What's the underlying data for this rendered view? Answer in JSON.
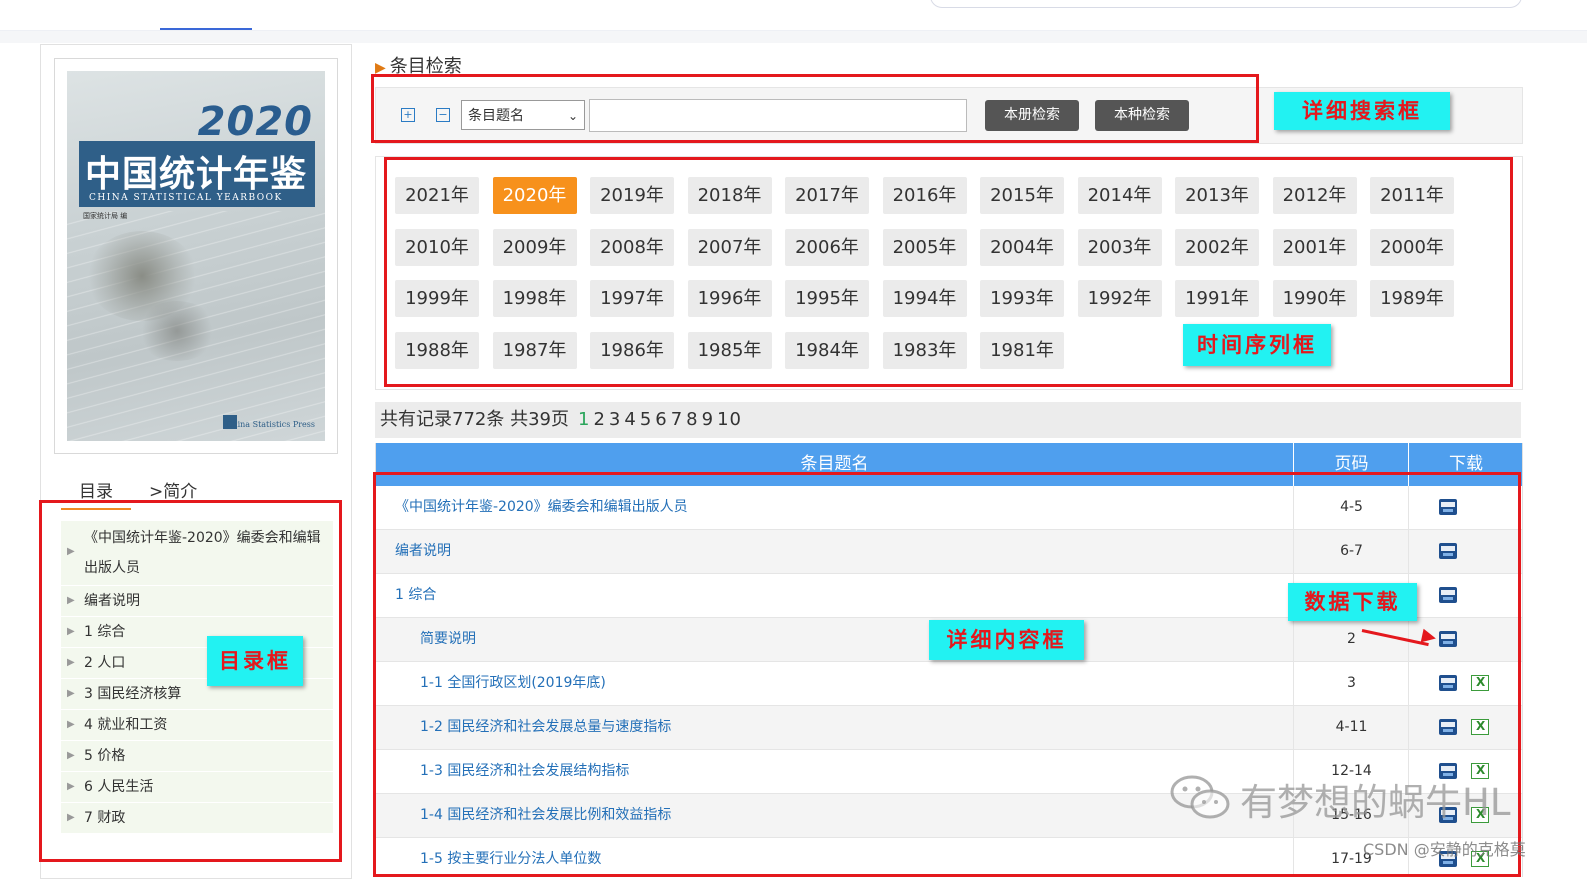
{
  "cover": {
    "year": "2020",
    "title_cn": "中国统计年鉴",
    "title_en": "CHINA STATISTICAL YEARBOOK",
    "editor": "国家统计局 编",
    "publisher": "China Statistics Press"
  },
  "left_tabs": {
    "catalog": "目录",
    "intro": ">简介"
  },
  "toc": [
    "《中国统计年鉴-2020》编委会和编辑出版人员",
    "编者说明",
    "1 综合",
    "2 人口",
    "3 国民经济核算",
    "4 就业和工资",
    "5 价格",
    "6 人民生活",
    "7 财政"
  ],
  "section_title": "条目检索",
  "search": {
    "field_selected": "条目题名",
    "input_value": "",
    "btn_this_volume": "本册检索",
    "btn_this_type": "本种检索"
  },
  "years": [
    "2021年",
    "2020年",
    "2019年",
    "2018年",
    "2017年",
    "2016年",
    "2015年",
    "2014年",
    "2013年",
    "2012年",
    "2011年",
    "2010年",
    "2009年",
    "2008年",
    "2007年",
    "2006年",
    "2005年",
    "2004年",
    "2003年",
    "2002年",
    "2001年",
    "2000年",
    "1999年",
    "1998年",
    "1997年",
    "1996年",
    "1995年",
    "1994年",
    "1993年",
    "1992年",
    "1991年",
    "1990年",
    "1989年",
    "1988年",
    "1987年",
    "1986年",
    "1985年",
    "1984年",
    "1983年",
    "1981年"
  ],
  "active_year": "2020年",
  "records": {
    "summary": "共有记录772条  共39页",
    "pages": [
      "1",
      "2",
      "3",
      "4",
      "5",
      "6",
      "7",
      "8",
      "9",
      "10"
    ],
    "current_page": "1"
  },
  "table": {
    "headers": {
      "title": "条目题名",
      "page": "页码",
      "download": "下载"
    },
    "rows": [
      {
        "title": "《中国统计年鉴-2020》编委会和编辑出版人员",
        "page": "4-5",
        "indent": 0,
        "excel": false
      },
      {
        "title": "编者说明",
        "page": "6-7",
        "indent": 0,
        "excel": false
      },
      {
        "title": "1 综合",
        "page": "",
        "indent": 0,
        "excel": false
      },
      {
        "title": "简要说明",
        "page": "2",
        "indent": 1,
        "excel": false
      },
      {
        "title": "1-1 全国行政区划(2019年底)",
        "page": "3",
        "indent": 1,
        "excel": true
      },
      {
        "title": "1-2 国民经济和社会发展总量与速度指标",
        "page": "4-11",
        "indent": 1,
        "excel": true
      },
      {
        "title": "1-3 国民经济和社会发展结构指标",
        "page": "12-14",
        "indent": 1,
        "excel": true
      },
      {
        "title": "1-4 国民经济和社会发展比例和效益指标",
        "page": "15-16",
        "indent": 1,
        "excel": true
      },
      {
        "title": "1-5 按主要行业分法人单位数",
        "page": "17-19",
        "indent": 1,
        "excel": true
      }
    ]
  },
  "annotations": {
    "search_box": "详细搜索框",
    "time_series": "时间序列框",
    "catalog_box": "目录框",
    "data_download": "数据下载",
    "content_box": "详细内容框"
  },
  "watermark": "有梦想的蜗牛HL",
  "csdn": "CSDN @安静的克格莫",
  "colors": {
    "accent_orange": "#f7911c",
    "header_blue": "#4f9fee",
    "annotation_red": "#e4181d",
    "annotation_cyan": "#22f2f2",
    "link_blue": "#2470b8",
    "toc_bg": "#f3f8ee"
  }
}
